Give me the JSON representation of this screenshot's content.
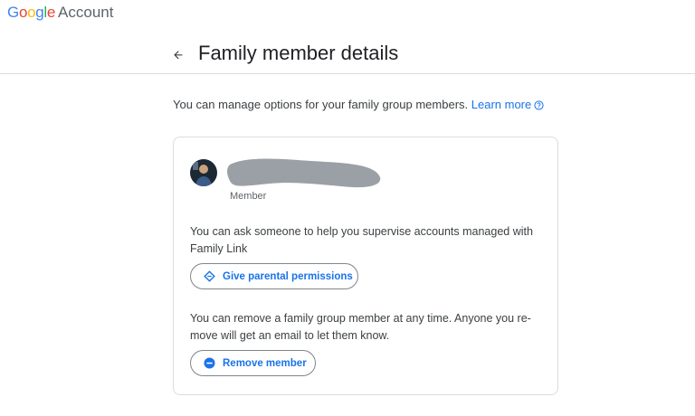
{
  "app": {
    "logo_text": "Google",
    "product_name": "Account"
  },
  "header": {
    "title": "Family member details"
  },
  "intro": {
    "text": "You can manage options for your family group members.",
    "learn_more": "Learn more"
  },
  "member": {
    "role": "Member"
  },
  "parental": {
    "description": "You can ask someone to help you supervise accounts managed with Family Link",
    "button_label": "Give parental permissions"
  },
  "remove": {
    "description": "You can remove a family group member at any time. Anyone you re-move will get an email to let them know.",
    "button_label": "Remove member"
  },
  "colors": {
    "link_blue": "#1a73e8",
    "border_gray": "#dadce0",
    "text_gray": "#3c4043"
  },
  "icons": [
    "arrow-back-icon",
    "help-circle-icon",
    "diamond-icon",
    "minus-circle-icon"
  ]
}
